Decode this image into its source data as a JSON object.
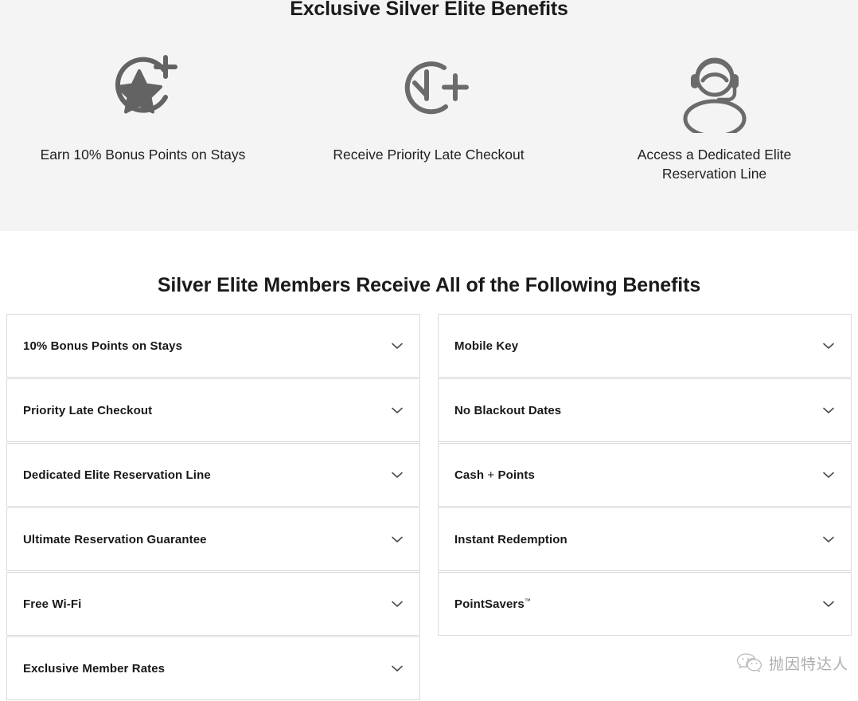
{
  "hero": {
    "title": "Exclusive Silver Elite Benefits",
    "items": [
      {
        "icon": "star-circle-plus-icon",
        "label": "Earn 10% Bonus Points on Stays"
      },
      {
        "icon": "clock-plus-icon",
        "label": "Receive Priority Late Checkout"
      },
      {
        "icon": "headset-agent-icon",
        "label": "Access a Dedicated Elite Reservation Line"
      }
    ]
  },
  "section": {
    "heading": "Silver Elite Members Receive All of the Following Benefits"
  },
  "accordion": {
    "chevron_icon": "chevron-down-icon",
    "left_column": [
      {
        "label": "10% Bonus Points on Stays"
      },
      {
        "label": "Priority Late Checkout"
      },
      {
        "label": "Dedicated Elite Reservation Line"
      },
      {
        "label": "Ultimate Reservation Guarantee"
      },
      {
        "label": "Free Wi-Fi"
      },
      {
        "label": "Exclusive Member Rates"
      }
    ],
    "right_column": [
      {
        "label": "Mobile Key"
      },
      {
        "label": "No Blackout Dates"
      },
      {
        "label": "Cash + Points",
        "split": [
          "Cash ",
          "+",
          " Points"
        ]
      },
      {
        "label": "Instant Redemption"
      },
      {
        "label": "PointSavers",
        "trademark": "™"
      }
    ]
  },
  "watermark": {
    "icon": "wechat-icon",
    "text": "抛因特达人"
  },
  "colors": {
    "hero_background": "#f4f4f4",
    "page_background": "#ffffff",
    "text_primary": "#1a1a1a",
    "icon_stroke": "#636363",
    "card_border": "#dadada",
    "chevron": "#4a4a4a"
  }
}
